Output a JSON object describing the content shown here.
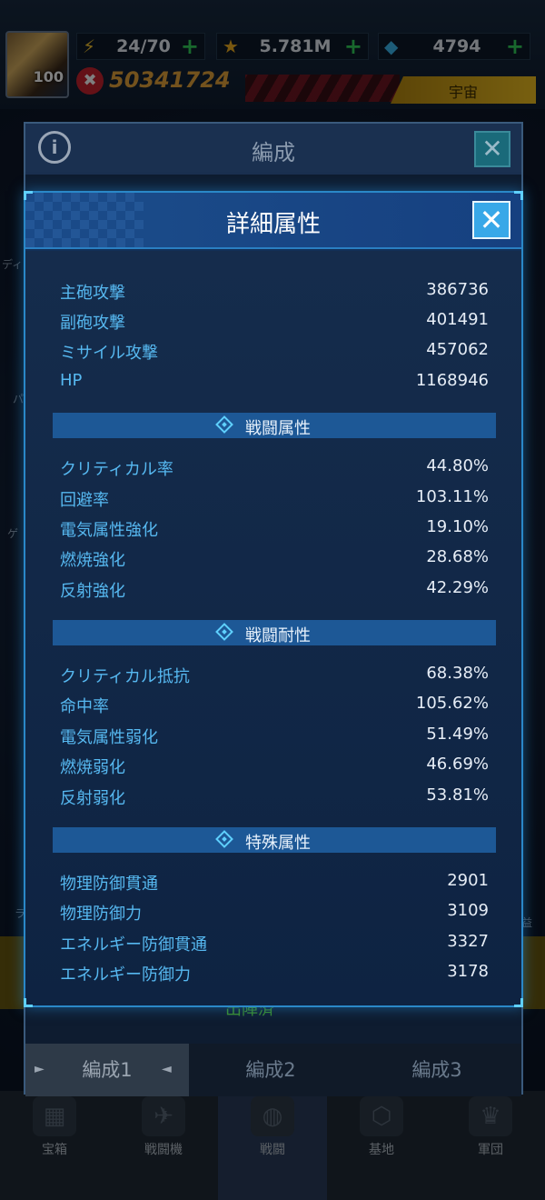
{
  "hud": {
    "avatar_level": "100",
    "energy": "24/70",
    "stars": "5.781M",
    "gems": "4794",
    "power": "50341724",
    "region": "宇宙",
    "plus": "+"
  },
  "bottom_nav": {
    "items": [
      {
        "label": "宝箱"
      },
      {
        "label": "戦闘機"
      },
      {
        "label": "戦闘"
      },
      {
        "label": "基地"
      },
      {
        "label": "軍団"
      }
    ]
  },
  "team_dialog": {
    "title": "編成",
    "info_glyph": "i",
    "close_glyph": "✕",
    "partial_text": "出陣済",
    "tabs": [
      {
        "label": "編成1"
      },
      {
        "label": "編成2"
      },
      {
        "label": "編成3"
      }
    ]
  },
  "side_labels": {
    "left1": "ディ",
    "left2": "パ",
    "left3": "ゲ",
    "left4": "ラ",
    "right1": "益"
  },
  "detail": {
    "title": "詳細属性",
    "close_glyph": "✕",
    "basic": [
      {
        "label": "主砲攻撃",
        "value": "386736"
      },
      {
        "label": "副砲攻撃",
        "value": "401491"
      },
      {
        "label": "ミサイル攻撃",
        "value": "457062"
      },
      {
        "label": "HP",
        "value": "1168946"
      }
    ],
    "sections": [
      {
        "title": "戦闘属性",
        "rows": [
          {
            "label": "クリティカル率",
            "value": "44.80%"
          },
          {
            "label": "回避率",
            "value": "103.11%"
          },
          {
            "label": "電気属性強化",
            "value": "19.10%"
          },
          {
            "label": "燃焼強化",
            "value": "28.68%"
          },
          {
            "label": "反射強化",
            "value": "42.29%"
          }
        ]
      },
      {
        "title": "戦闘耐性",
        "rows": [
          {
            "label": "クリティカル抵抗",
            "value": "68.38%"
          },
          {
            "label": "命中率",
            "value": "105.62%"
          },
          {
            "label": "電気属性弱化",
            "value": "51.49%"
          },
          {
            "label": "燃焼弱化",
            "value": "46.69%"
          },
          {
            "label": "反射弱化",
            "value": "53.81%"
          }
        ]
      },
      {
        "title": "特殊属性",
        "rows": [
          {
            "label": "物理防御貫通",
            "value": "2901"
          },
          {
            "label": "物理防御力",
            "value": "3109"
          },
          {
            "label": "エネルギー防御貫通",
            "value": "3327"
          },
          {
            "label": "エネルギー防御力",
            "value": "3178"
          }
        ]
      }
    ]
  }
}
